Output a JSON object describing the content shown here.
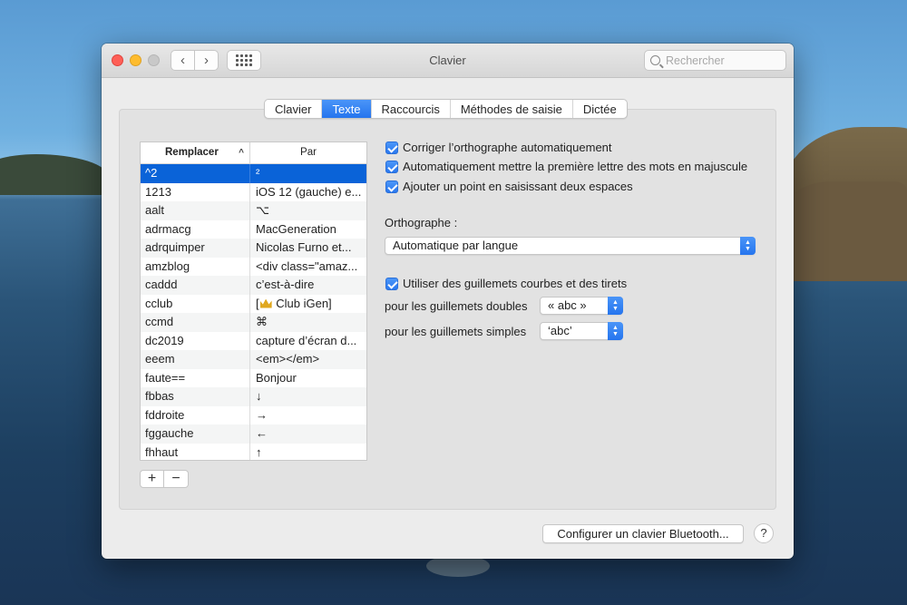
{
  "window": {
    "title": "Clavier",
    "search_placeholder": "Rechercher"
  },
  "titlebar": {
    "back_glyph": "‹",
    "forward_glyph": "›"
  },
  "tabs": [
    {
      "label": "Clavier"
    },
    {
      "label": "Texte",
      "active": true
    },
    {
      "label": "Raccourcis"
    },
    {
      "label": "Méthodes de saisie"
    },
    {
      "label": "Dictée"
    }
  ],
  "table": {
    "col_replace": "Remplacer",
    "col_with": "Par",
    "sort_glyph": "^",
    "rows": [
      {
        "replace": "^2",
        "with": "²"
      },
      {
        "replace": "1213",
        "with": "iOS 12 (gauche) e..."
      },
      {
        "replace": "aalt",
        "with": "⌥"
      },
      {
        "replace": "adrmacg",
        "with": "MacGeneration"
      },
      {
        "replace": "adrquimper",
        "with": "Nicolas Furno et..."
      },
      {
        "replace": "amzblog",
        "with": "<div class=\"amaz..."
      },
      {
        "replace": "caddd",
        "with": "c’est-à-dire"
      },
      {
        "replace": "cclub",
        "with_prefix": "[",
        "with": "Club iGen]"
      },
      {
        "replace": "ccmd",
        "with": "⌘"
      },
      {
        "replace": "dc2019",
        "with": "capture d’écran d..."
      },
      {
        "replace": "eeem",
        "with": "<em></em>"
      },
      {
        "replace": "faute==",
        "with": "Bonjour"
      },
      {
        "replace": "fbbas",
        "with": "↓"
      },
      {
        "replace": "fddroite",
        "with": "→"
      },
      {
        "replace": "fggauche",
        "with": "←"
      },
      {
        "replace": "fhhaut",
        "with": "↑"
      }
    ],
    "add_label": "+",
    "remove_label": "−"
  },
  "options": {
    "autocorrect": "Corriger l’orthographe automatiquement",
    "capitalize": "Automatiquement mettre la première lettre des mots en majuscule",
    "period": "Ajouter un point en saisissant deux espaces",
    "spelling_label": "Orthographe :",
    "spelling_value": "Automatique par langue",
    "smart_quotes": "Utiliser des guillemets courbes et des tirets",
    "double_label": "pour les guillemets doubles",
    "double_value": "« abc »",
    "single_label": "pour les guillemets simples",
    "single_value": "‘abc’"
  },
  "footer": {
    "bluetooth_button": "Configurer un clavier Bluetooth...",
    "help": "?"
  },
  "colors": {
    "accent": "#2575ee",
    "selection": "#0a63d8"
  }
}
